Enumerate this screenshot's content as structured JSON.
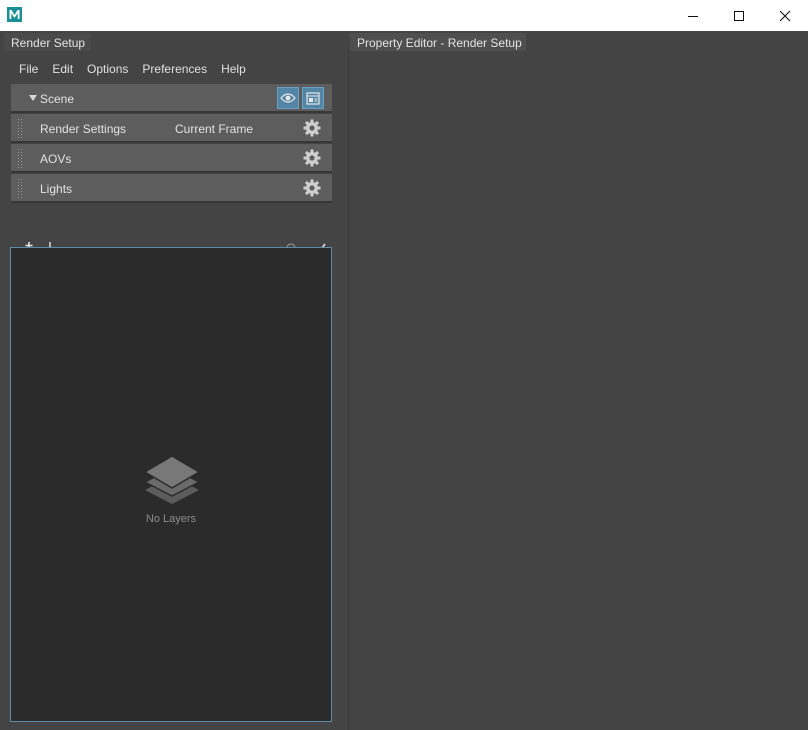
{
  "window": {
    "app_logo": "M",
    "controls": [
      "minimize-icon",
      "maximize-icon",
      "close-icon"
    ]
  },
  "render_setup": {
    "tab_title": "Render Setup",
    "menu": [
      "File",
      "Edit",
      "Options",
      "Preferences",
      "Help"
    ],
    "scene": {
      "label": "Scene",
      "buttons": [
        "eye-icon",
        "render-view-icon"
      ]
    },
    "rows": [
      {
        "label": "Render Settings",
        "value": "Current Frame"
      },
      {
        "label": "AOVs",
        "value": ""
      },
      {
        "label": "Lights",
        "value": ""
      }
    ],
    "toolbar": {
      "left": [
        "create-layer-icon",
        "import-layer-icon"
      ],
      "right": [
        "render-all-layers-icon",
        "accept-icon"
      ]
    },
    "layers": {
      "empty_text": "No Layers"
    }
  },
  "property_editor": {
    "tab_title": "Property Editor - Render Setup"
  },
  "colors": {
    "background": "#444444",
    "row": "#5d5d5d",
    "list_bg": "#2b2b2b",
    "accent": "#5285a6",
    "highlight": "#e4312f"
  }
}
